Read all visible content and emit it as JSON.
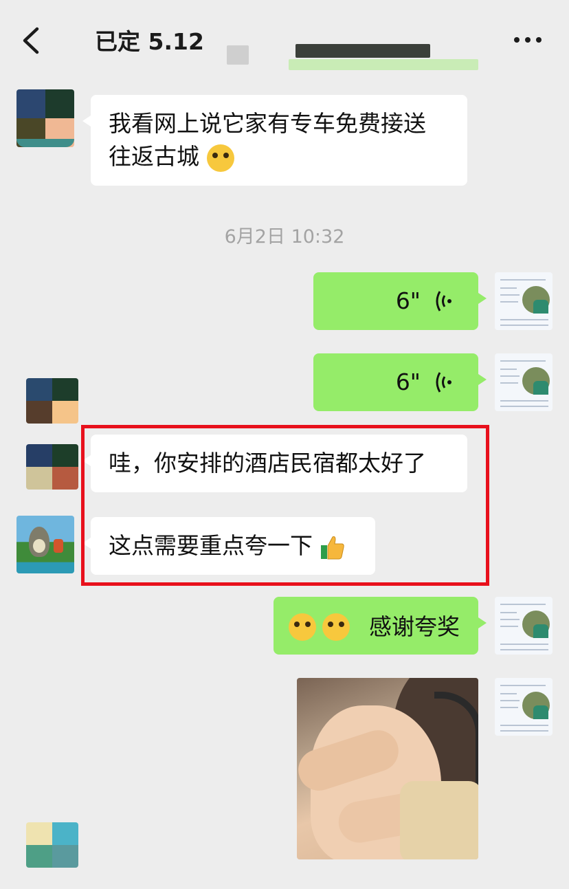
{
  "header": {
    "title": "已定 5.12",
    "back_icon": "chevron-left-icon",
    "more_icon": "more-dots-icon"
  },
  "timestamp": "6月2日 10:32",
  "messages": [
    {
      "side": "left",
      "text_line1": "我看网上说它家有专车免费接送",
      "text_line2": "往返古城",
      "emoji": "shush-face"
    },
    {
      "side": "right",
      "type": "voice",
      "duration": "6\""
    },
    {
      "side": "right",
      "type": "voice",
      "duration": "6\""
    },
    {
      "side": "left",
      "text": "哇，你安排的酒店民宿都太好了"
    },
    {
      "side": "left",
      "text": "这点需要重点夸一下",
      "emoji": "thumbs-up"
    },
    {
      "side": "right",
      "text": "感谢夸奖",
      "emoji": "pleading-face"
    },
    {
      "side": "right",
      "type": "image",
      "content": "photo"
    }
  ],
  "colors": {
    "background": "#ededed",
    "my_bubble": "#95ec69",
    "their_bubble": "#ffffff",
    "highlight_box": "#e8101c"
  }
}
